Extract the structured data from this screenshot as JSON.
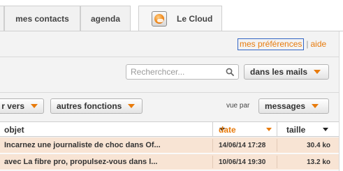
{
  "tabs": [
    {
      "label": "mes contacts"
    },
    {
      "label": "agenda"
    },
    {
      "label": "Le Cloud",
      "icon": "cloud-app-icon"
    }
  ],
  "top_links": {
    "preferences": "mes préférences",
    "separator": "|",
    "help": "aide"
  },
  "search": {
    "placeholder": "Recherchcer...",
    "value": "",
    "icon": "search-icon",
    "scope_label": "dans les mails"
  },
  "toolbar": {
    "move_to_label": "r vers",
    "other_functions_label": "autres fonctions",
    "view_by_label": "vue par",
    "view_mode_label": "messages"
  },
  "table": {
    "columns": {
      "subject": "objet",
      "date": "date",
      "size": "taille"
    },
    "rows": [
      {
        "subject": "Incarnez une journaliste de choc dans Of...",
        "date": "14/06/14 17:28",
        "size": "30.4 ko"
      },
      {
        "subject": "avec La fibre pro, propulsez-vous dans l...",
        "date": "10/06/14 19:30",
        "size": "13.2 ko"
      }
    ]
  },
  "colors": {
    "accent": "#e87b0c",
    "unread_row": "#f8e4d4",
    "focus_border": "#3365c4"
  }
}
